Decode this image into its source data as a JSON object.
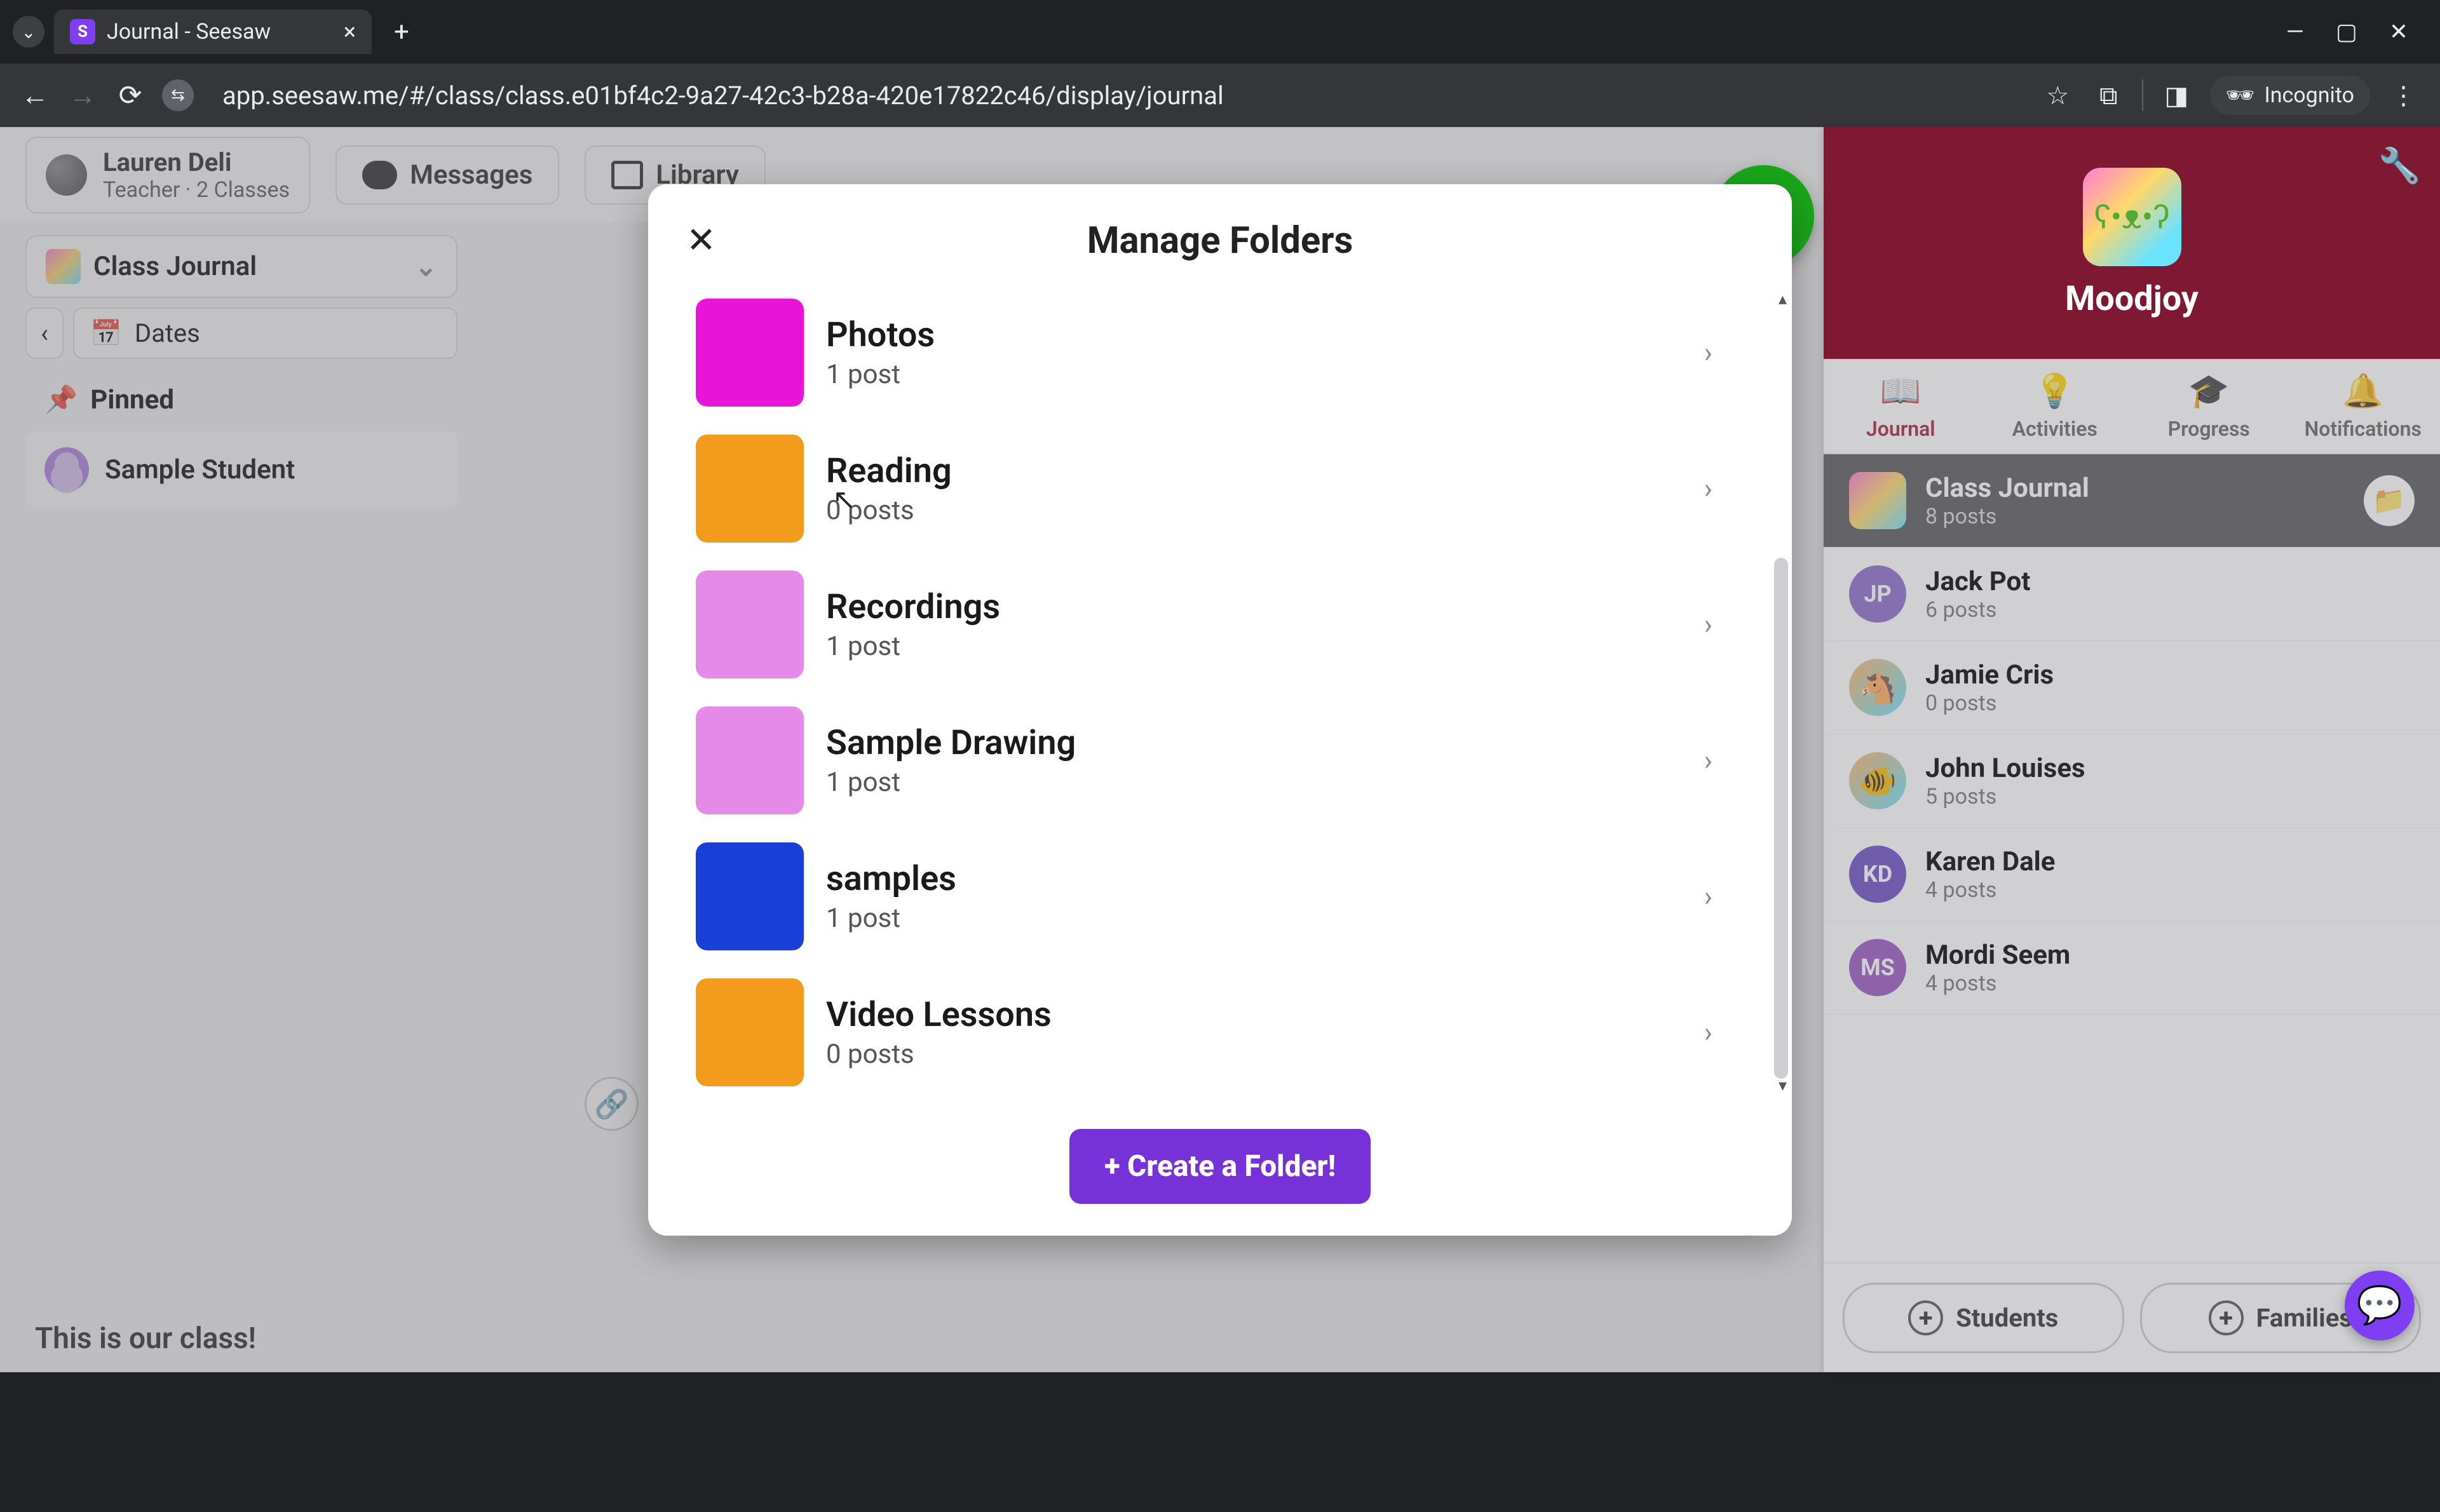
{
  "browser": {
    "tab_title": "Journal - Seesaw",
    "url": "app.seesaw.me/#/class/class.e01bf4c2-9a27-42c3-b28a-420e17822c46/display/journal",
    "incognito_label": "Incognito"
  },
  "teacher": {
    "name": "Lauren Deli",
    "subtitle": "Teacher · 2 Classes"
  },
  "topnav": {
    "messages": "Messages",
    "library": "Library"
  },
  "left": {
    "class_journal": "Class Journal",
    "dates": "Dates",
    "pinned": "Pinned",
    "student": "Sample Student"
  },
  "add_fab": "Add",
  "caption": "This is our class!",
  "class_header": {
    "name": "Moodjoy"
  },
  "tabs": {
    "journal": "Journal",
    "activities": "Activities",
    "progress": "Progress",
    "notifications": "Notifications"
  },
  "journal_rows": [
    {
      "name": "Class Journal",
      "sub": "8 posts",
      "avatar_type": "rainbow",
      "initials": "",
      "active": true,
      "has_folder": true
    },
    {
      "name": "Jack Pot",
      "sub": "6 posts",
      "avatar_type": "initials",
      "initials": "JP",
      "color": "#8b6cc9"
    },
    {
      "name": "Jamie Cris",
      "sub": "0 posts",
      "avatar_type": "emoji",
      "initials": "🐴"
    },
    {
      "name": "John Louises",
      "sub": "5 posts",
      "avatar_type": "emoji",
      "initials": "🐠"
    },
    {
      "name": "Karen Dale",
      "sub": "4 posts",
      "avatar_type": "initials",
      "initials": "KD",
      "color": "#6b4fc4"
    },
    {
      "name": "Mordi Seem",
      "sub": "4 posts",
      "avatar_type": "initials",
      "initials": "MS",
      "color": "#9a56c0"
    }
  ],
  "bottom_buttons": {
    "students": "Students",
    "families": "Families"
  },
  "modal": {
    "title": "Manage Folders",
    "create": "+ Create a Folder!",
    "folders": [
      {
        "name": "Photos",
        "sub": "1 post",
        "color": "#e815d8"
      },
      {
        "name": "Reading",
        "sub": "0 posts",
        "color": "#f29b1d"
      },
      {
        "name": "Recordings",
        "sub": "1 post",
        "color": "#e58ae8"
      },
      {
        "name": "Sample Drawing",
        "sub": "1 post",
        "color": "#e58ae8"
      },
      {
        "name": "samples",
        "sub": "1 post",
        "color": "#1a3fd6"
      },
      {
        "name": "Video Lessons",
        "sub": "0 posts",
        "color": "#f29b1d"
      }
    ]
  }
}
